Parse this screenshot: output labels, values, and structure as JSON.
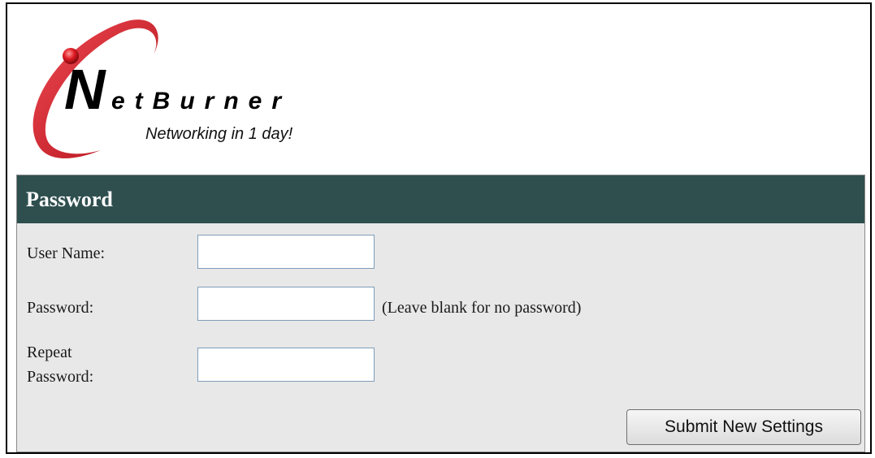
{
  "logo": {
    "brand_initial": "N",
    "brand_rest": "etBurner",
    "tagline": "Networking in 1 day!"
  },
  "panel": {
    "title": "Password"
  },
  "form": {
    "username_label": "User Name:",
    "username_value": "",
    "password_label": "Password:",
    "password_value": "",
    "password_hint": "(Leave blank for no password)",
    "repeat_label_line1": "Repeat",
    "repeat_label_line2": "Password:",
    "repeat_value": "",
    "submit_label": "Submit New Settings"
  },
  "colors": {
    "header_bg": "#2f4f4f",
    "panel_bg": "#e8e8e8",
    "logo_red": "#e01b24"
  }
}
